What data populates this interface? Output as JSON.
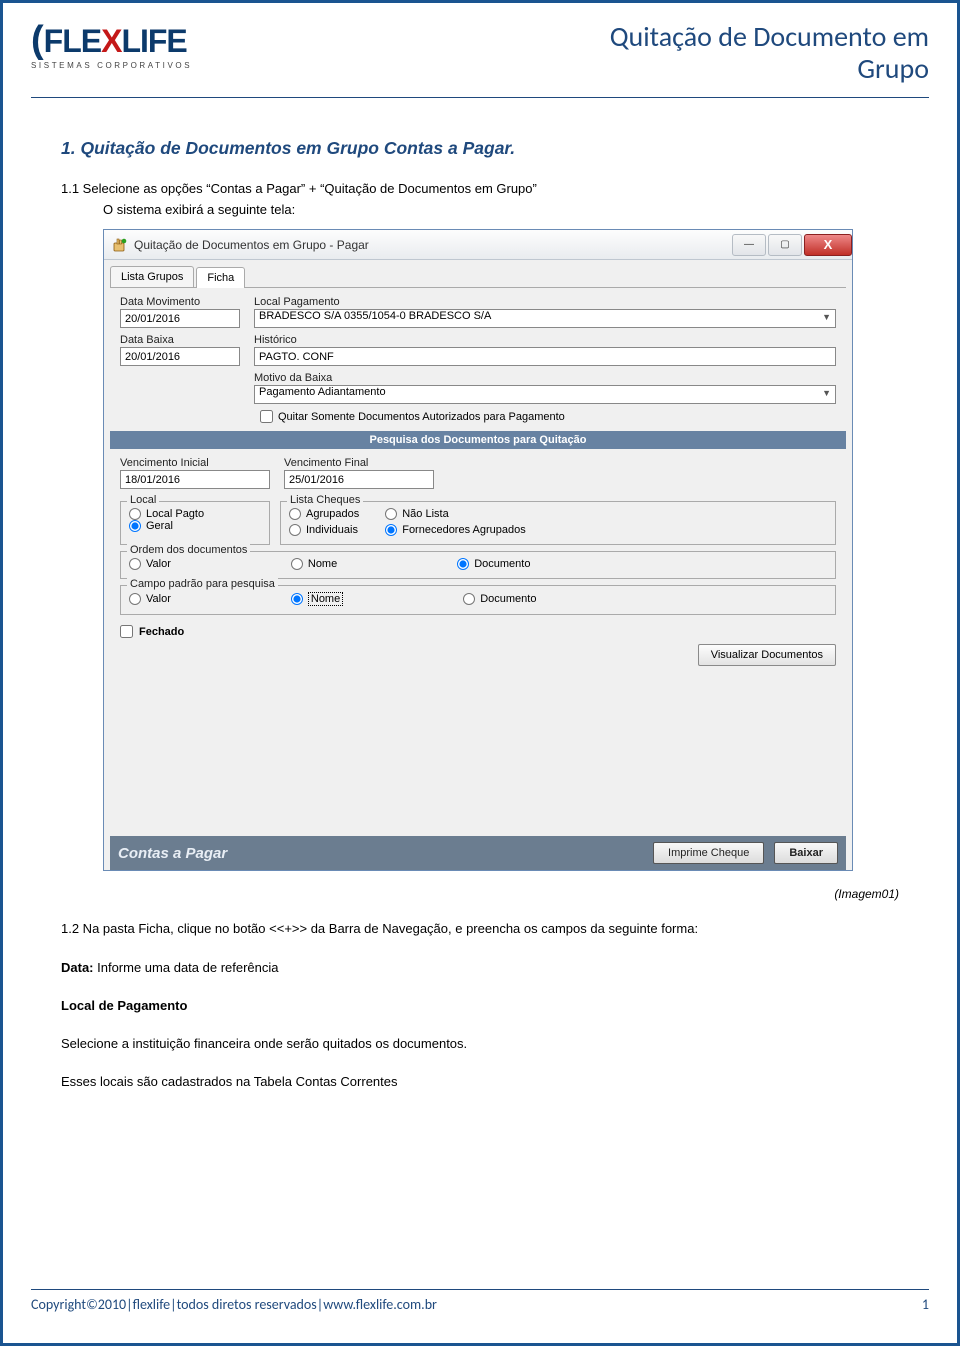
{
  "header": {
    "logo_text": "FLEXLIFE",
    "logo_sub": "SISTEMAS CORPORATIVOS",
    "doc_title_l1": "Quitação de Documento em",
    "doc_title_l2": "Grupo"
  },
  "content": {
    "h1": "1. Quitação de Documentos em Grupo Contas a Pagar.",
    "p1": "1.1 Selecione as opções “Contas a Pagar” + “Quitação de Documentos em Grupo”",
    "p1_sub": "O sistema exibirá a seguinte tela:",
    "caption": "(Imagem01)",
    "p2": "1.2 Na pasta Ficha, clique no botão <<+>> da Barra de Navegação, e preencha os campos da seguinte forma:",
    "p3_label": "Data:",
    "p3_text": " Informe uma data de referência",
    "p4_label": "Local de Pagamento",
    "p5": "Selecione a instituição financeira onde serão quitados os documentos.",
    "p6": "Esses locais são cadastrados na Tabela Contas Correntes"
  },
  "screenshot": {
    "window_title": "Quitação de Documentos em Grupo - Pagar",
    "tabs": {
      "t1": "Lista Grupos",
      "t2": "Ficha"
    },
    "labels": {
      "data_mov": "Data Movimento",
      "local_pag": "Local Pagamento",
      "data_baixa": "Data Baixa",
      "historico": "Histórico",
      "motivo": "Motivo da Baixa",
      "chk_autorizados": "Quitar Somente Documentos Autorizados para Pagamento",
      "section": "Pesquisa dos Documentos para Quitação",
      "venc_ini": "Vencimento Inicial",
      "venc_fim": "Vencimento Final",
      "local_group": "Local",
      "lista_cheques": "Lista Cheques",
      "ordem": "Ordem dos documentos",
      "campo_pesq": "Campo padrão para pesquisa",
      "fechado": "Fechado",
      "visualizar": "Visualizar Documentos",
      "footer_left": "Contas a Pagar",
      "imprime": "Imprime Cheque",
      "baixar": "Baixar"
    },
    "values": {
      "data_mov": "20/01/2016",
      "local_pag": "BRADESCO S/A 0355/1054-0 BRADESCO S/A",
      "data_baixa": "20/01/2016",
      "historico": "PAGTO. CONF",
      "motivo": "Pagamento Adiantamento",
      "venc_ini": "18/01/2016",
      "venc_fim": "25/01/2016"
    },
    "radios": {
      "local_pagto": "Local Pagto",
      "geral": "Geral",
      "agrupados": "Agrupados",
      "individuais": "Individuais",
      "nao_lista": "Não Lista",
      "forn_agrup": "Fornecedores Agrupados",
      "valor": "Valor",
      "nome": "Nome",
      "documento": "Documento"
    }
  },
  "footer": {
    "copyright": "Copyright©2010|flexlife|todos diretos reservados|www.flexlife.com.br",
    "page": "1"
  }
}
